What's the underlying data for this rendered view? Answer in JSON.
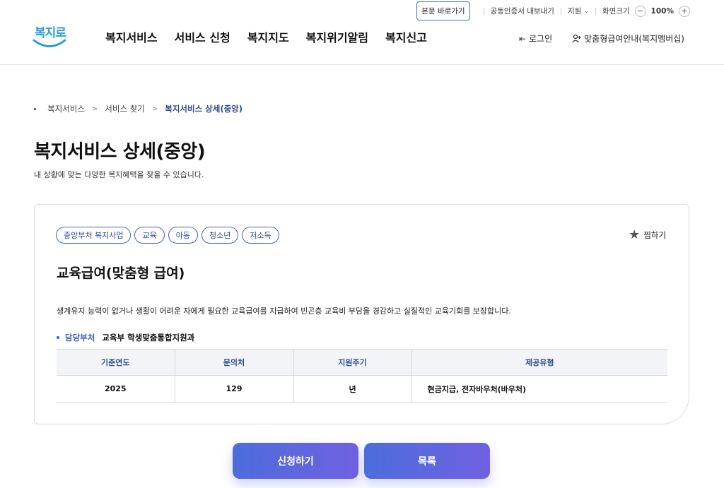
{
  "header": {
    "logo_text": "복지로",
    "util": {
      "skip_label": "본문 바로가기",
      "cert_label": "공동인증서 내보내기",
      "support_label": "지원",
      "zoom_label": "화면크기",
      "zoom_value": "100%"
    },
    "nav": [
      "복지서비스",
      "서비스 신청",
      "복지지도",
      "복지위기알림",
      "복지신고"
    ],
    "login_label": "로그인",
    "membership_label": "맞춤형급여안내(복지멤버십)"
  },
  "breadcrumb": [
    "복지서비스",
    "서비스 찾기",
    "복지서비스 상세(중앙)"
  ],
  "page": {
    "title": "복지서비스 상세(중앙)",
    "description": "내 상황에 맞는 다양한 복지혜택을 찾을 수 있습니다."
  },
  "service": {
    "tags": [
      "중앙부처 복지사업",
      "교육",
      "아동",
      "청소년",
      "저소득"
    ],
    "favorite_label": "찜하기",
    "title": "교육급여(맞춤형 급여)",
    "description": "생계유지 능력이 없거나 생활이 어려운 자에게 필요한 교육급여를 지급하여 빈곤층 교육비 부담을 경감하고 실질적인 교육기회를 보장합니다.",
    "dept_label": "담당부처",
    "dept_value": "교육부 학생맞춤통합지원과",
    "table": {
      "headers": [
        "기준연도",
        "문의처",
        "지원주기",
        "제공유형"
      ],
      "row": [
        "2025",
        "129",
        "년",
        "현금지급, 전자바우처(바우처)"
      ]
    }
  },
  "actions": {
    "apply_label": "신청하기",
    "list_label": "목록"
  },
  "colors": {
    "accent": "#4766b8",
    "button_gradient_start": "#4d6ddb",
    "button_gradient_end": "#6f61e0",
    "logo": "#2a9bd6"
  }
}
